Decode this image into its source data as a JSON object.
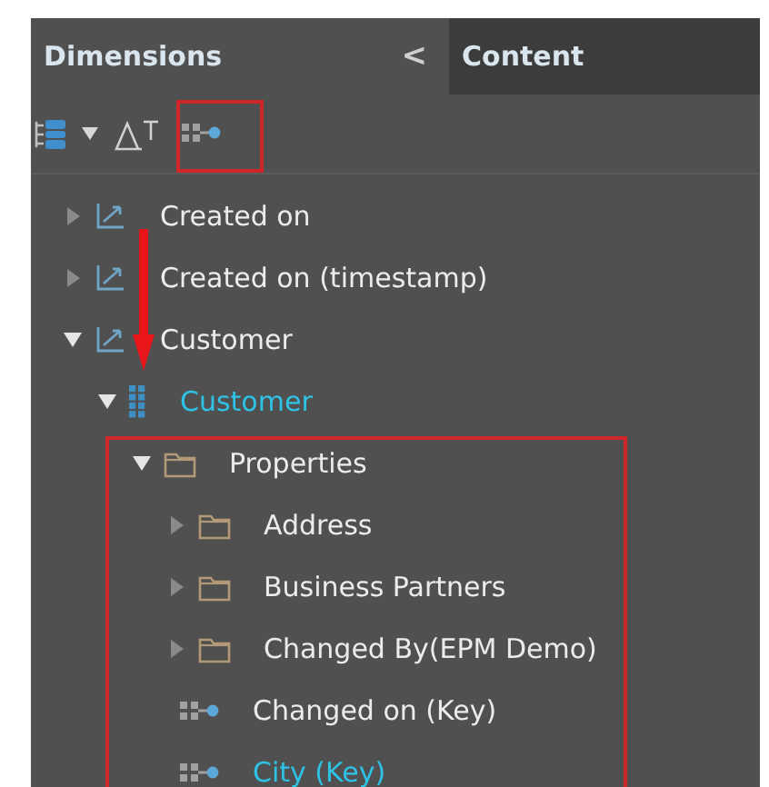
{
  "tabs": [
    {
      "label": "Dimensions",
      "selected": true
    },
    {
      "label": "Content",
      "selected": false
    }
  ],
  "collapse_symbol": "<",
  "tree": [
    {
      "label": "Created on",
      "kind": "measure",
      "expanded": false,
      "active": false
    },
    {
      "label": "Created on (timestamp)",
      "kind": "measure",
      "expanded": false,
      "active": false
    },
    {
      "label": "Customer",
      "kind": "measure",
      "expanded": true,
      "active": false,
      "children": [
        {
          "label": "Customer",
          "kind": "dimension",
          "expanded": true,
          "active": true,
          "children": [
            {
              "label": "Properties",
              "kind": "folder",
              "expanded": true,
              "active": false,
              "children": [
                {
                  "label": "Address",
                  "kind": "folder",
                  "expanded": false,
                  "active": false
                },
                {
                  "label": "Business Partners",
                  "kind": "folder",
                  "expanded": false,
                  "active": false
                },
                {
                  "label": "Changed By(EPM Demo)",
                  "kind": "folder",
                  "expanded": false,
                  "active": false
                },
                {
                  "label": "Changed on (Key)",
                  "kind": "attribute",
                  "active": false
                },
                {
                  "label": "City (Key)",
                  "kind": "attribute",
                  "active": true
                }
              ]
            }
          ]
        }
      ]
    }
  ]
}
